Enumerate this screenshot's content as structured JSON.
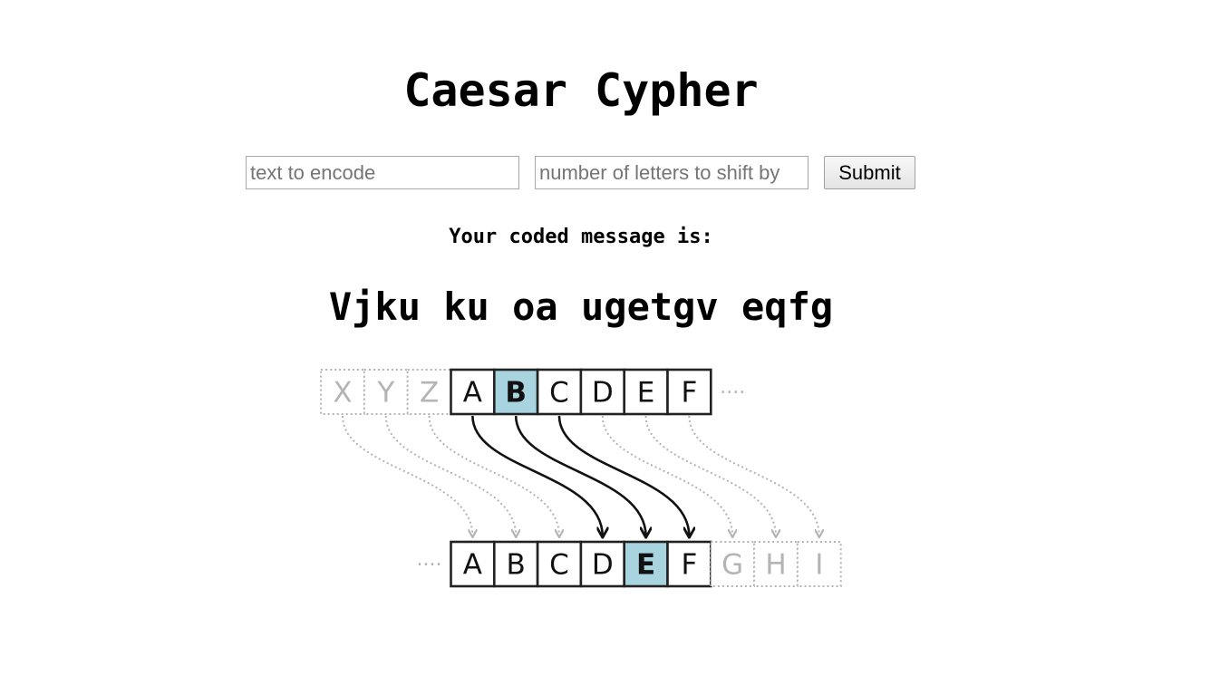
{
  "page": {
    "title": "Caesar Cypher"
  },
  "form": {
    "text_input": {
      "value": "",
      "placeholder": "text to encode"
    },
    "shift_input": {
      "value": "",
      "placeholder": "number of letters to shift by"
    },
    "submit_label": "Submit"
  },
  "result": {
    "label": "Your coded message is:",
    "message": "Vjku ku oa ugetgv eqfg"
  },
  "diagram": {
    "shift": 3,
    "top_row": {
      "before_faded": [
        "X",
        "Y",
        "Z"
      ],
      "letters": [
        "A",
        "B",
        "C",
        "D",
        "E",
        "F"
      ],
      "highlighted": "B",
      "ellipsis": "····"
    },
    "bottom_row": {
      "ellipsis": "····",
      "letters": [
        "A",
        "B",
        "C",
        "D",
        "E",
        "F"
      ],
      "after_faded": [
        "G",
        "H",
        "I"
      ],
      "highlighted": "E"
    },
    "colors": {
      "highlight": "#a8d4e0",
      "solid_border": "#222222",
      "faded": "#b4b4b4",
      "arrow": "#111111"
    }
  }
}
